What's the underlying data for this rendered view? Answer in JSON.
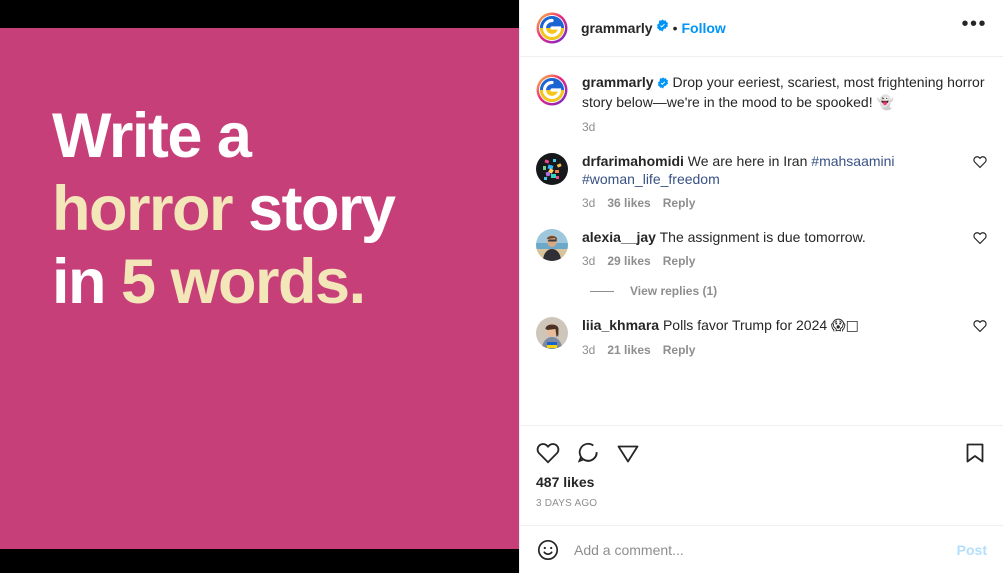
{
  "media": {
    "background_color": "#C63F79",
    "letterbox_color": "#000000",
    "accent_text_color": "#F3E6B8",
    "lines": [
      {
        "segments": [
          {
            "text": "Write a",
            "style": "white"
          }
        ]
      },
      {
        "segments": [
          {
            "text": "horror ",
            "style": "cream"
          },
          {
            "text": "story",
            "style": "white"
          }
        ]
      },
      {
        "segments": [
          {
            "text": "in ",
            "style": "white"
          },
          {
            "text": "5 words.",
            "style": "cream"
          }
        ]
      }
    ]
  },
  "header": {
    "username": "grammarly",
    "verified": true,
    "separator": "•",
    "follow_label": "Follow",
    "more_label": "•••"
  },
  "caption": {
    "username": "grammarly",
    "verified": true,
    "text": "Drop your eeriest, scariest, most frightening horror story below—we're in the mood to be spooked! ",
    "emoji": "👻",
    "timestamp": "3d"
  },
  "comments": [
    {
      "username": "drfarimahomidi",
      "text": "We are here in Iran ",
      "hashtags": [
        "#mahsaamini",
        "#woman_life_freedom"
      ],
      "timestamp": "3d",
      "likes": "36 likes",
      "reply_label": "Reply",
      "avatar_type": "confetti-avatar",
      "replies": null
    },
    {
      "username": "alexia__jay",
      "text": "The assignment is due tomorrow.",
      "hashtags": [],
      "timestamp": "3d",
      "likes": "29 likes",
      "reply_label": "Reply",
      "avatar_type": "beach-portrait-avatar",
      "replies": "View replies (1)"
    },
    {
      "username": "liia_khmara",
      "text": "Polls favor Trump for 2024 ",
      "emoji": "😱□",
      "hashtags": [],
      "timestamp": "3d",
      "likes": "21 likes",
      "reply_label": "Reply",
      "avatar_type": "portrait-flag-avatar",
      "replies": null
    }
  ],
  "actions": {
    "like_icon": "heart-icon",
    "comment_icon": "comment-icon",
    "share_icon": "share-icon",
    "save_icon": "bookmark-icon",
    "likes_count": "487 likes",
    "time_ago": "3 DAYS AGO"
  },
  "add_comment": {
    "emoji_icon": "emoji-smiley-icon",
    "placeholder": "Add a comment...",
    "value": "",
    "post_label": "Post"
  },
  "colors": {
    "link_blue": "#0095F6",
    "hashtag_blue": "#385185",
    "text_primary": "#262626",
    "text_secondary": "#8e8e8e"
  }
}
